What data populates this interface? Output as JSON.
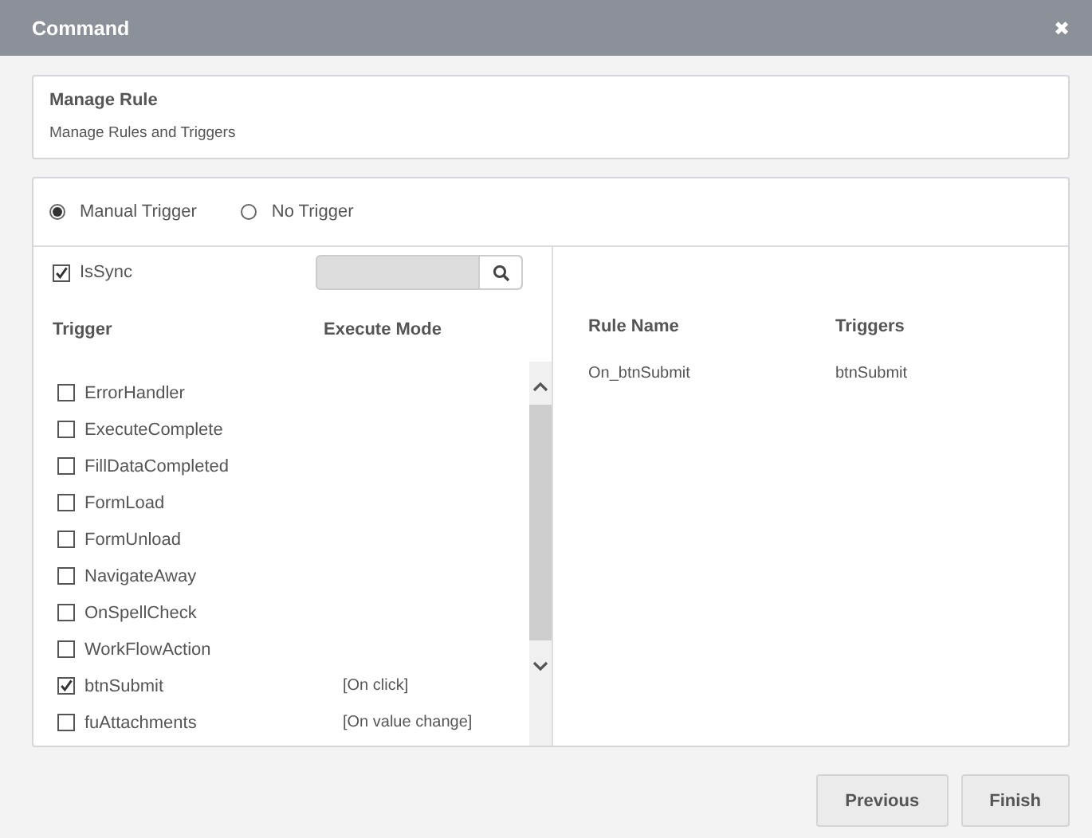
{
  "window": {
    "title": "Command",
    "close": "✖"
  },
  "header": {
    "title": "Manage Rule",
    "subtitle": "Manage Rules and Triggers"
  },
  "trigger_options": [
    {
      "label": "Manual Trigger",
      "selected": true
    },
    {
      "label": "No Trigger",
      "selected": false
    }
  ],
  "is_sync": {
    "label": "IsSync",
    "checked": true
  },
  "trigger_table": {
    "columns": [
      "Trigger",
      "Execute Mode"
    ],
    "rows": [
      {
        "name": "ErrorHandler",
        "checked": false
      },
      {
        "name": "ExecuteComplete",
        "checked": false
      },
      {
        "name": "FillDataCompleted",
        "checked": false
      },
      {
        "name": "FormLoad",
        "checked": false
      },
      {
        "name": "FormUnload",
        "checked": false
      },
      {
        "name": "NavigateAway",
        "checked": false
      },
      {
        "name": "OnSpellCheck",
        "checked": false
      },
      {
        "name": "WorkFlowAction",
        "checked": false
      },
      {
        "name": "btnSubmit",
        "checked": true,
        "mode": "[On click]"
      },
      {
        "name": "fuAttachments",
        "checked": false,
        "mode": "[On value change]"
      }
    ]
  },
  "rule_table": {
    "columns": [
      "Rule Name",
      "Triggers"
    ],
    "rows": [
      {
        "rule_name": "On_btnSubmit",
        "triggers": "btnSubmit"
      }
    ]
  },
  "buttons": [
    "Previous",
    "Finish"
  ]
}
